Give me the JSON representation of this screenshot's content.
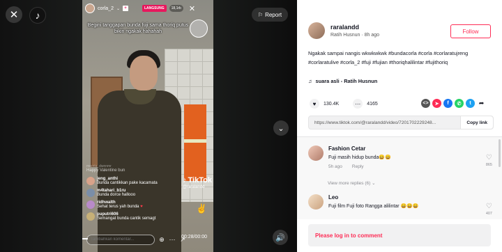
{
  "report_label": "Report",
  "live": {
    "host_name": "corla_2",
    "live_badge": "LANGSUNG",
    "viewers": "18,1rb",
    "caption": "Begini tanggapan bunda fuji sama thoriq putus bikin ngakak hahahah",
    "faded_user": "mooria_dwnnmr",
    "faded_msg": "Happy Valentine bun",
    "chat": [
      {
        "user": "jeng_anthi",
        "msg": "Bunda cantikkan pake kacamata",
        "color": "#d9a38a"
      },
      {
        "user": "m4tahari_b1ru",
        "msg": "Bunda dorce hallooo",
        "color": "#7a8ea8"
      },
      {
        "user": "ridhwalth",
        "msg": "Sehat terus yah bunda",
        "color": "#b88ac9"
      },
      {
        "user": "puputri606",
        "msg": "Semangat bunda cantik semagt",
        "color": "#c7b077"
      }
    ],
    "watermark_logo": "TikTok",
    "watermark_user": "@raralandd",
    "comment_placeholder": "Tambahkan komentar...",
    "time": "00:28/00:00"
  },
  "author": {
    "username": "raralandd",
    "nickname": "Ratih Husnun",
    "time_ago": "8h ago",
    "follow_label": "Follow"
  },
  "description": {
    "text": "Ngakak sampai nangis wkwkwkwk",
    "tags": [
      "#bundacorla",
      "#corla",
      "#corlaratujreng",
      "#corlaratulive",
      "#corla_2",
      "#fuji",
      "#fujian",
      "#thoriqhalilintar",
      "#fujithoriq"
    ]
  },
  "sound": "suara asli - Ratih Husnun",
  "stats": {
    "likes": "130.4K",
    "comments": "4165"
  },
  "share": {
    "link": "https://www.tiktok.com/@raralandd/video/7201702229248...",
    "copy_label": "Copy link"
  },
  "comments": [
    {
      "name": "Fashion Cetar",
      "text": "Fuji masih hidup bunda😄😄",
      "time": "5h ago",
      "reply": "Reply",
      "likes": "865"
    },
    {
      "name": "Leo",
      "text": "Fuji film Fuji foto Rangga alilintar 😄😄😄",
      "likes": "407"
    }
  ],
  "more_replies": "View more replies (6)",
  "login_prompt": "Please log in to comment",
  "colors": {
    "accent": "#fe2c55",
    "live": "#e8175d"
  }
}
